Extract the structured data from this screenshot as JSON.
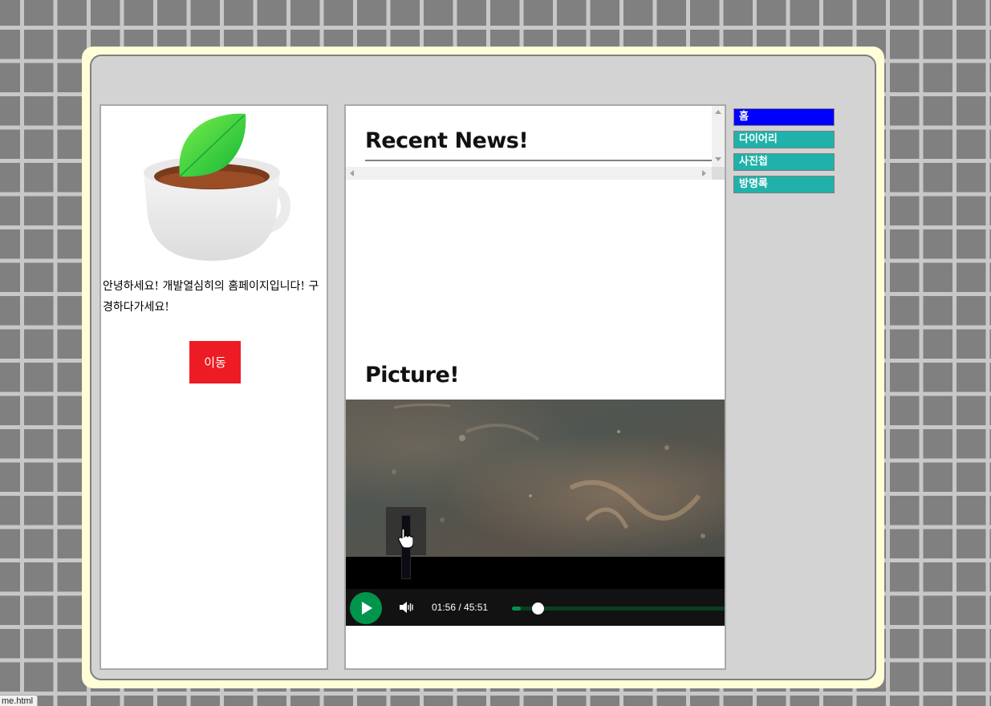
{
  "profile": {
    "greeting": "안녕하세요! 개발열심히의 홈페이지입니다! 구경하다가세요!",
    "go_button": "이동"
  },
  "news": {
    "title": "Recent News!"
  },
  "picture": {
    "title": "Picture!"
  },
  "video": {
    "time": "01:56 / 45:51",
    "progress_fraction": 0.0423,
    "accent_color": "#00954a"
  },
  "nav": {
    "items": [
      {
        "label": "홈",
        "active": true
      },
      {
        "label": "다이어리",
        "active": false
      },
      {
        "label": "사진첩",
        "active": false
      },
      {
        "label": "방명록",
        "active": false
      }
    ]
  },
  "status_bar": {
    "url_text": "me.html"
  },
  "colors": {
    "frame_border": "#fffed6",
    "panel_bg": "#d3d3d3",
    "button_red": "#ed1c24",
    "nav_active": "#0000ff",
    "nav_normal": "#20b2aa"
  }
}
